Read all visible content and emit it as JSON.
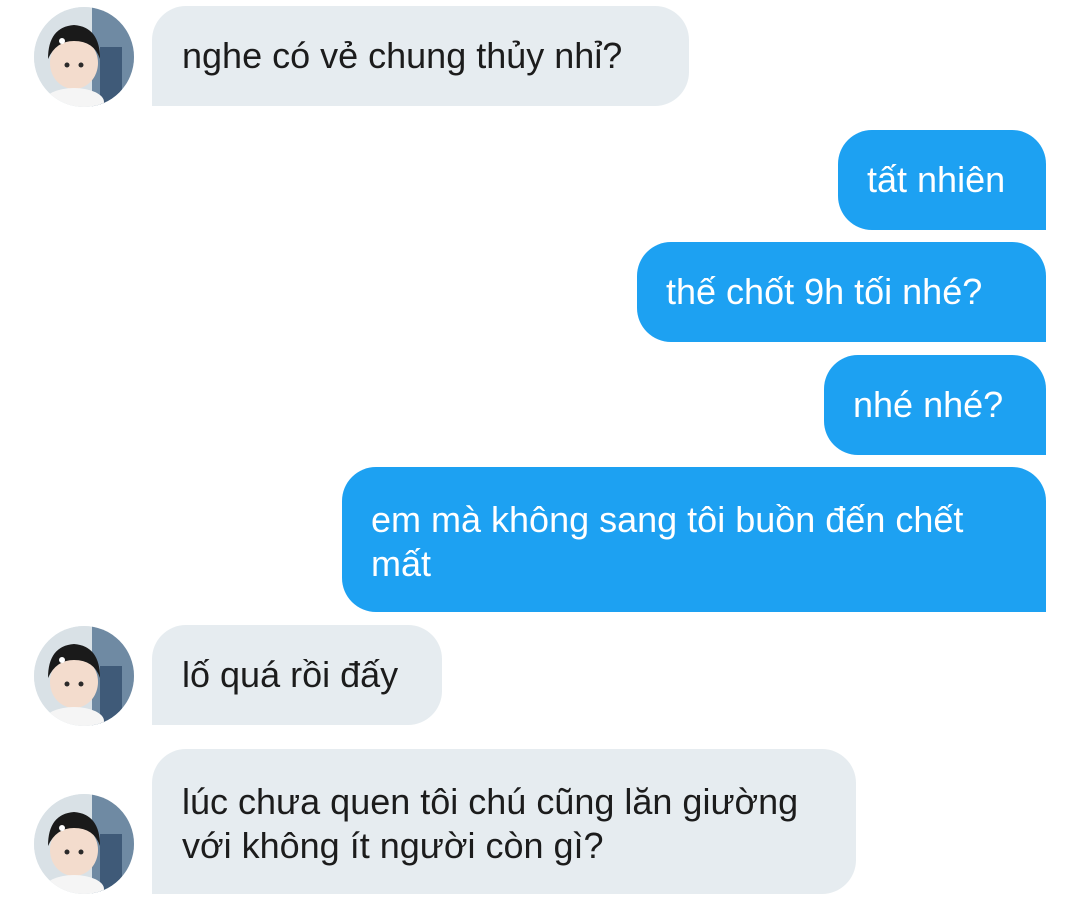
{
  "messages": [
    {
      "sender": "them",
      "text": "nghe có vẻ chung thủy nhỉ?"
    },
    {
      "sender": "me",
      "text": "tất nhiên"
    },
    {
      "sender": "me",
      "text": "thế chốt 9h tối nhé?"
    },
    {
      "sender": "me",
      "text": "nhé nhé?"
    },
    {
      "sender": "me",
      "text": "em mà không sang tôi buồn đến chết mất"
    },
    {
      "sender": "them",
      "text": "lố quá rồi đấy"
    },
    {
      "sender": "them",
      "text": "lúc chưa quen tôi chú cũng lăn giường với không ít người còn gì?"
    }
  ],
  "avatar": {
    "icon": "child-photo-avatar"
  },
  "colors": {
    "incoming_bubble": "#e6ecf0",
    "outgoing_bubble": "#1da1f2",
    "incoming_text": "#1c1c1c",
    "outgoing_text": "#ffffff"
  }
}
